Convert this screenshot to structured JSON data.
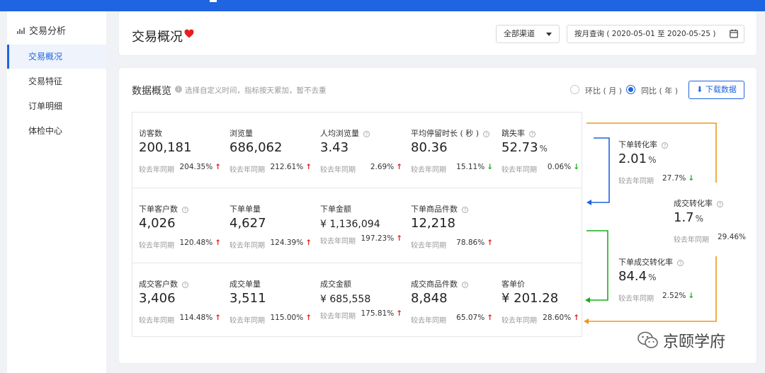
{
  "sidebar": {
    "section_title": "交易分析",
    "items": [
      {
        "label": "交易概况",
        "active": true
      },
      {
        "label": "交易特征",
        "active": false
      },
      {
        "label": "订单明细",
        "active": false
      },
      {
        "label": "体检中心",
        "active": false
      }
    ]
  },
  "header": {
    "title": "交易概况",
    "channel_select": "全部渠道",
    "date_range": "按月查询 ( 2020-05-01 至 2020-05-25 )"
  },
  "overview": {
    "title": "数据概览",
    "hint": "选择自定义时间，指标按天累加，暂不去重",
    "radio_mom": "环比 ( 月 )",
    "radio_yoy": "同比 ( 年 )",
    "selected": "yoy",
    "download": "下载数据",
    "compare_label": "较去年同期",
    "rows": [
      [
        {
          "label": "访客数",
          "value": "200,181",
          "pct": "204.35%",
          "trend": "up",
          "help": false
        },
        {
          "label": "浏览量",
          "value": "686,062",
          "pct": "212.61%",
          "trend": "up",
          "help": false
        },
        {
          "label": "人均浏览量",
          "value": "3.43",
          "pct": "2.69%",
          "trend": "up",
          "help": true
        },
        {
          "label": "平均停留时长 ( 秒 )",
          "value": "80.36",
          "pct": "15.11%",
          "trend": "down",
          "help": true
        },
        {
          "label": "跳失率",
          "value": "52.73",
          "unit": "%",
          "pct": "0.06%",
          "trend": "down",
          "help": true
        }
      ],
      [
        {
          "label": "下单客户数",
          "value": "4,026",
          "pct": "120.48%",
          "trend": "up",
          "help": true
        },
        {
          "label": "下单单量",
          "value": "4,627",
          "pct": "124.39%",
          "trend": "up",
          "help": false
        },
        {
          "label": "下单金额",
          "value": "¥ 1,136,094",
          "pct": "197.23%",
          "trend": "up",
          "help": false,
          "small": true
        },
        {
          "label": "下单商品件数",
          "value": "12,218",
          "pct": "78.86%",
          "trend": "up",
          "help": true
        }
      ],
      [
        {
          "label": "成交客户数",
          "value": "3,406",
          "pct": "114.48%",
          "trend": "up",
          "help": true
        },
        {
          "label": "成交单量",
          "value": "3,511",
          "pct": "115.00%",
          "trend": "up",
          "help": false
        },
        {
          "label": "成交金额",
          "value": "¥ 685,558",
          "pct": "175.81%",
          "trend": "up",
          "help": false,
          "small": true
        },
        {
          "label": "成交商品件数",
          "value": "8,848",
          "pct": "65.07%",
          "trend": "up",
          "help": true
        },
        {
          "label": "客单价",
          "value": "¥ 201.28",
          "pct": "28.60%",
          "trend": "up",
          "help": false
        }
      ]
    ],
    "conversions": [
      {
        "label": "下单转化率",
        "value": "2.01",
        "unit": "%",
        "pct": "27.7%",
        "trend": "down"
      },
      {
        "label": "成交转化率",
        "value": "1.7",
        "unit": "%",
        "pct": "29.46%",
        "trend": ""
      },
      {
        "label": "下单成交转化率",
        "value": "84.4",
        "unit": "%",
        "pct": "2.52%",
        "trend": "down"
      }
    ]
  },
  "watermark": "京颐学府",
  "colors": {
    "brand": "#1f64e0",
    "up": "#e02020",
    "down": "#1aad19",
    "flow_orange": "#f0961e",
    "flow_blue": "#1f64e0",
    "flow_green": "#1aad19"
  }
}
